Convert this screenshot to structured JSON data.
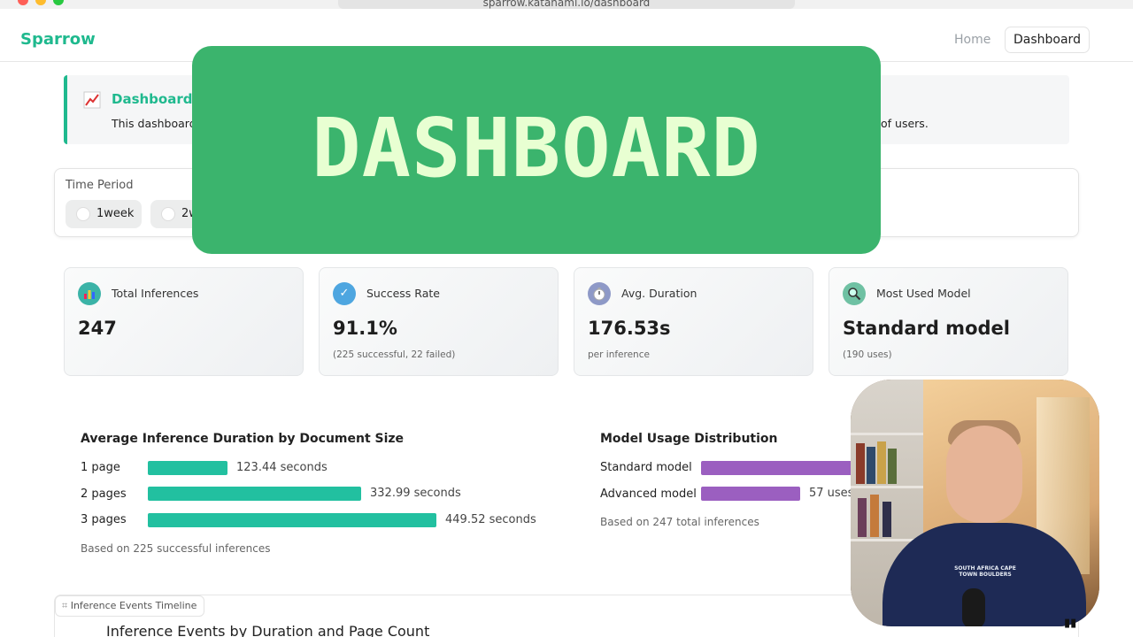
{
  "browser": {
    "url": "sparrow.katanaml.io/dashboard"
  },
  "nav": {
    "brand": "Sparrow",
    "home": "Home",
    "dashboard": "Dashboard"
  },
  "banner": {
    "icon": "chart-increasing-icon",
    "title": "Dashboard In",
    "text": "This dashboard",
    "text_tail": "ion of users."
  },
  "period": {
    "label": "Time Period",
    "options": [
      "1week",
      "2w"
    ]
  },
  "metrics": [
    {
      "label": "Total Inferences",
      "value": "247",
      "sub": "",
      "icon": "bar-chart-icon",
      "color": "#3bb3a7"
    },
    {
      "label": "Success Rate",
      "value": "91.1%",
      "sub": "(225 successful, 22 failed)",
      "icon": "check-icon",
      "color": "#4ea6e0"
    },
    {
      "label": "Avg. Duration",
      "value": "176.53s",
      "sub": "per inference",
      "icon": "stopwatch-icon",
      "color": "#8e99c7"
    },
    {
      "label": "Most Used Model",
      "value": "Standard model",
      "sub": "(190 uses)",
      "icon": "magnifier-icon",
      "color": "#6fc1a3"
    }
  ],
  "chart_data": [
    {
      "type": "bar",
      "title": "Average Inference Duration by Document Size",
      "categories": [
        "1 page",
        "2 pages",
        "3 pages"
      ],
      "values": [
        123.44,
        332.99,
        449.52
      ],
      "value_labels": [
        "123.44 seconds",
        "332.99 seconds",
        "449.52 seconds"
      ],
      "note": "Based on 225 successful inferences",
      "color": "#22c0a0"
    },
    {
      "type": "bar",
      "title": "Model Usage Distribution",
      "categories": [
        "Standard model",
        "Advanced model"
      ],
      "values": [
        190,
        57
      ],
      "value_labels": [
        "",
        "57 uses"
      ],
      "note": "Based on 247 total inferences",
      "color": "#9b5fc0"
    }
  ],
  "timeline": {
    "tab": "Inference Events Timeline",
    "title": "Inference Events by Duration and Page Count"
  },
  "overlay": {
    "text": "DASHBOARD"
  },
  "webcam": {
    "shirt_text": "SOUTH AFRICA CAPE TOWN BOULDERS"
  }
}
